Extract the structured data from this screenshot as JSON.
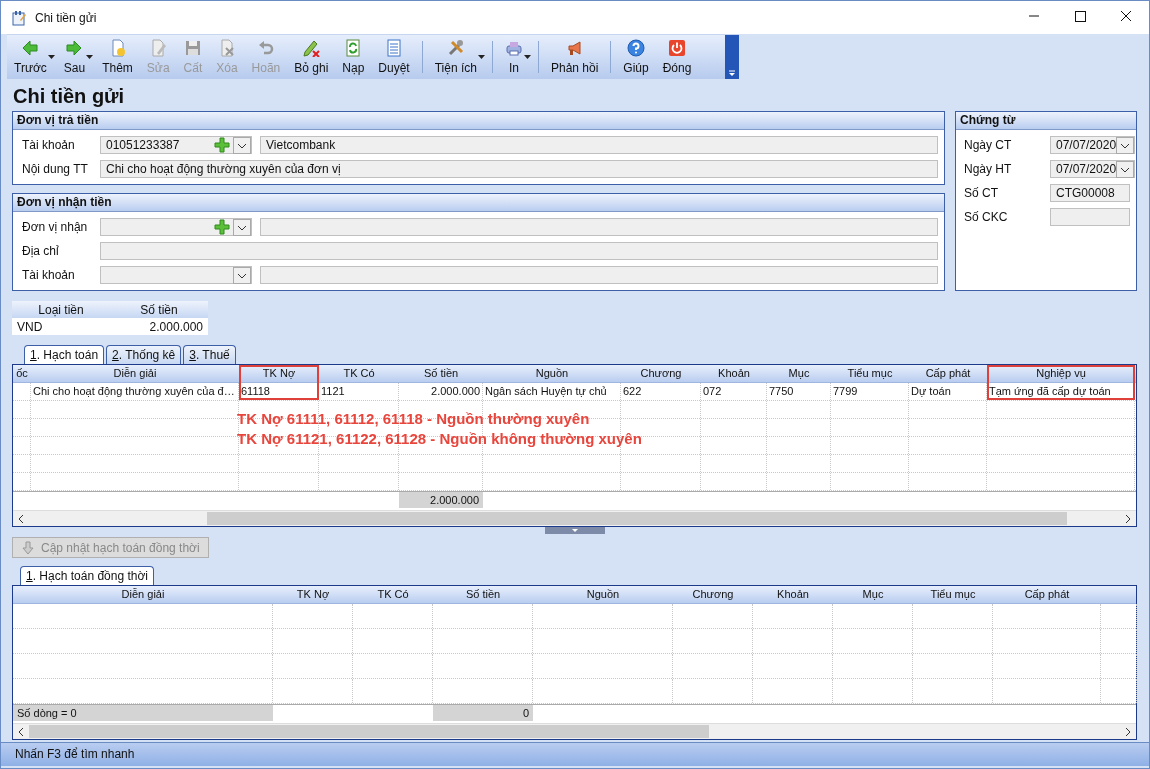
{
  "window": {
    "title": "Chi tiền gửi"
  },
  "toolbar": {
    "items": [
      {
        "kind": "button",
        "label": "Trước",
        "disabled": false,
        "dropdown": true
      },
      {
        "kind": "button",
        "label": "Sau",
        "disabled": false,
        "dropdown": true
      },
      {
        "kind": "button",
        "label": "Thêm",
        "disabled": false,
        "dropdown": false
      },
      {
        "kind": "button",
        "label": "Sửa",
        "disabled": true,
        "dropdown": false
      },
      {
        "kind": "button",
        "label": "Cất",
        "disabled": true,
        "dropdown": false
      },
      {
        "kind": "button",
        "label": "Xóa",
        "disabled": true,
        "dropdown": false
      },
      {
        "kind": "button",
        "label": "Hoãn",
        "disabled": true,
        "dropdown": false
      },
      {
        "kind": "button",
        "label": "Bỏ ghi",
        "disabled": false,
        "dropdown": false
      },
      {
        "kind": "button",
        "label": "Nạp",
        "disabled": false,
        "dropdown": false
      },
      {
        "kind": "button",
        "label": "Duyệt",
        "disabled": false,
        "dropdown": false
      },
      {
        "kind": "separator"
      },
      {
        "kind": "button",
        "label": "Tiện ích",
        "disabled": false,
        "dropdown": true
      },
      {
        "kind": "separator"
      },
      {
        "kind": "button",
        "label": "In",
        "disabled": false,
        "dropdown": true
      },
      {
        "kind": "separator"
      },
      {
        "kind": "button",
        "label": "Phản hồi",
        "disabled": false,
        "dropdown": false
      },
      {
        "kind": "separator"
      },
      {
        "kind": "button",
        "label": "Giúp",
        "disabled": false,
        "dropdown": false
      },
      {
        "kind": "button",
        "label": "Đóng",
        "disabled": false,
        "dropdown": false
      }
    ]
  },
  "heading": "Chi tiền gửi",
  "payer": {
    "title": "Đơn vị trả tiền",
    "fields": [
      {
        "kind": "lookup_add",
        "label": "Tài khoản",
        "value": "01051233387",
        "name_value": "Vietcombank"
      },
      {
        "kind": "text",
        "label": "Nội dung TT",
        "value": "Chi cho hoạt động thường xuyên của đơn vị"
      }
    ]
  },
  "receiver": {
    "title": "Đơn vị nhận tiền",
    "fields": [
      {
        "kind": "lookup_add",
        "label": "Đơn vị nhận"
      },
      {
        "kind": "text",
        "label": "Địa chỉ"
      },
      {
        "kind": "lookup",
        "label": "Tài khoản"
      }
    ]
  },
  "voucher": {
    "title": "Chứng từ",
    "fields": [
      {
        "kind": "date",
        "label": "Ngày CT",
        "value": "07/07/2020"
      },
      {
        "kind": "date",
        "label": "Ngày HT",
        "value": "07/07/2020"
      },
      {
        "kind": "text",
        "label": "Số CT",
        "value": "CTG00008"
      },
      {
        "kind": "text",
        "label": "Số CKC"
      }
    ]
  },
  "currency_table": {
    "columns": [
      "Loại tiền",
      "Số tiền"
    ],
    "rows": [
      [
        "VND",
        "2.000.000"
      ]
    ]
  },
  "tabs": [
    {
      "label": "1. Hạch toán",
      "selected": true
    },
    {
      "label": "2. Thống kê",
      "selected": false
    },
    {
      "label": "3. Thuế",
      "selected": false
    }
  ],
  "entries_grid": {
    "columns": [
      {
        "label": "ốc",
        "highlighted": false
      },
      {
        "label": "Diễn giải",
        "highlighted": false
      },
      {
        "label": "TK Nợ",
        "highlighted": true
      },
      {
        "label": "TK Có",
        "highlighted": false
      },
      {
        "label": "Số tiền",
        "highlighted": false
      },
      {
        "label": "Nguồn",
        "highlighted": false
      },
      {
        "label": "Chương",
        "highlighted": false
      },
      {
        "label": "Khoản",
        "highlighted": false
      },
      {
        "label": "Mục",
        "highlighted": false
      },
      {
        "label": "Tiểu mục",
        "highlighted": false
      },
      {
        "label": "Cấp phát",
        "highlighted": false
      },
      {
        "label": "Nghiệp vụ",
        "highlighted": true
      }
    ],
    "rows": [
      [
        "",
        "Chi cho hoạt động thường xuyên của đ…",
        "61118",
        "1121",
        "2.000.000",
        "Ngân sách Huyện tự chủ",
        "622",
        "072",
        "7750",
        "7799",
        "Dự toán",
        "Tạm ứng đã cấp dự toán"
      ]
    ],
    "footer": {
      "amount": "2.000.000"
    },
    "annotations": [
      "TK Nợ 61111, 61112, 61118 - Nguồn thường xuyên",
      "TK Nợ 61121, 61122, 61128 - Nguồn không thường xuyên"
    ]
  },
  "update_button": {
    "label": "Cập nhật hạch toán đồng thời",
    "disabled": true
  },
  "sub_tabs": [
    {
      "label": "1. Hạch toán đồng thời",
      "selected": true
    }
  ],
  "sub_grid": {
    "columns": [
      "Diễn giải",
      "TK Nợ",
      "TK Có",
      "Số tiền",
      "Nguồn",
      "Chương",
      "Khoản",
      "Mục",
      "Tiểu mục",
      "Cấp phát"
    ],
    "footer": {
      "row_count": "Số dòng = 0",
      "amount": "0"
    }
  },
  "status_bar": "Nhấn F3 để tìm nhanh"
}
